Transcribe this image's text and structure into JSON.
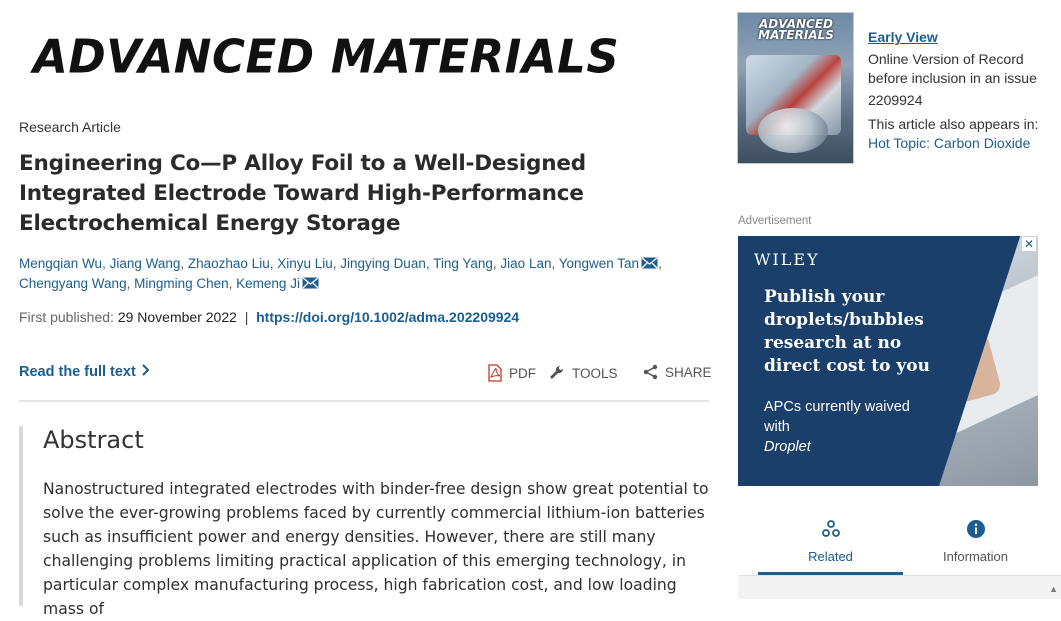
{
  "journal": {
    "logo_text": "ADVANCED MATERIALS"
  },
  "article": {
    "type": "Research Article",
    "title": "Engineering Co—P Alloy Foil to a Well-Designed Integrated Electrode Toward High-Performance Electrochemical Energy Storage",
    "authors": [
      {
        "name": "Mengqian Wu",
        "mail": false
      },
      {
        "name": "Jiang Wang",
        "mail": false
      },
      {
        "name": "Zhaozhao Liu",
        "mail": false
      },
      {
        "name": "Xinyu Liu",
        "mail": false
      },
      {
        "name": "Jingying Duan",
        "mail": false
      },
      {
        "name": "Ting Yang",
        "mail": false
      },
      {
        "name": "Jiao Lan",
        "mail": false
      },
      {
        "name": "Yongwen Tan",
        "mail": true
      },
      {
        "name": "Chengyang Wang",
        "mail": false
      },
      {
        "name": "Mingming Chen",
        "mail": false
      },
      {
        "name": "Kemeng Ji",
        "mail": true
      }
    ],
    "published_label": "First published:",
    "published_date": "29 November 2022",
    "separator": "|",
    "doi": "https://doi.org/10.1002/adma.202209924"
  },
  "actions": {
    "read_full": "Read the full text",
    "pdf": "PDF",
    "tools": "TOOLS",
    "share": "SHARE"
  },
  "abstract": {
    "heading": "Abstract",
    "text": "Nanostructured integrated electrodes with binder-free design show great potential to solve the ever-growing problems faced by currently commercial lithium-ion batteries such as insufficient power and energy densities. However, there are still many challenging problems limiting practical application of this emerging technology, in particular complex manufacturing process, high fabrication cost, and low loading mass of"
  },
  "sidebar": {
    "cover_title": "ADVANCED MATERIALS",
    "early_view": "Early View",
    "line1": "Online Version of Record",
    "line2": "before inclusion in an issue",
    "article_number": "2209924",
    "appears_in": "This article also appears in:",
    "hot_topic": "Hot Topic: Carbon Dioxide",
    "ad_label": "Advertisement"
  },
  "ad": {
    "brand": "WILEY",
    "headline": "Publish your droplets/bubbles research at no direct cost to you",
    "sub_prefix": "APCs currently waived with",
    "sub_em": "Droplet",
    "close": "✕"
  },
  "tabs": [
    {
      "label": "Related",
      "icon": "related-icon"
    },
    {
      "label": "Information",
      "icon": "info-icon"
    }
  ],
  "colors": {
    "link": "#1c5e8f",
    "ad_bg": "#1b3f6b"
  }
}
